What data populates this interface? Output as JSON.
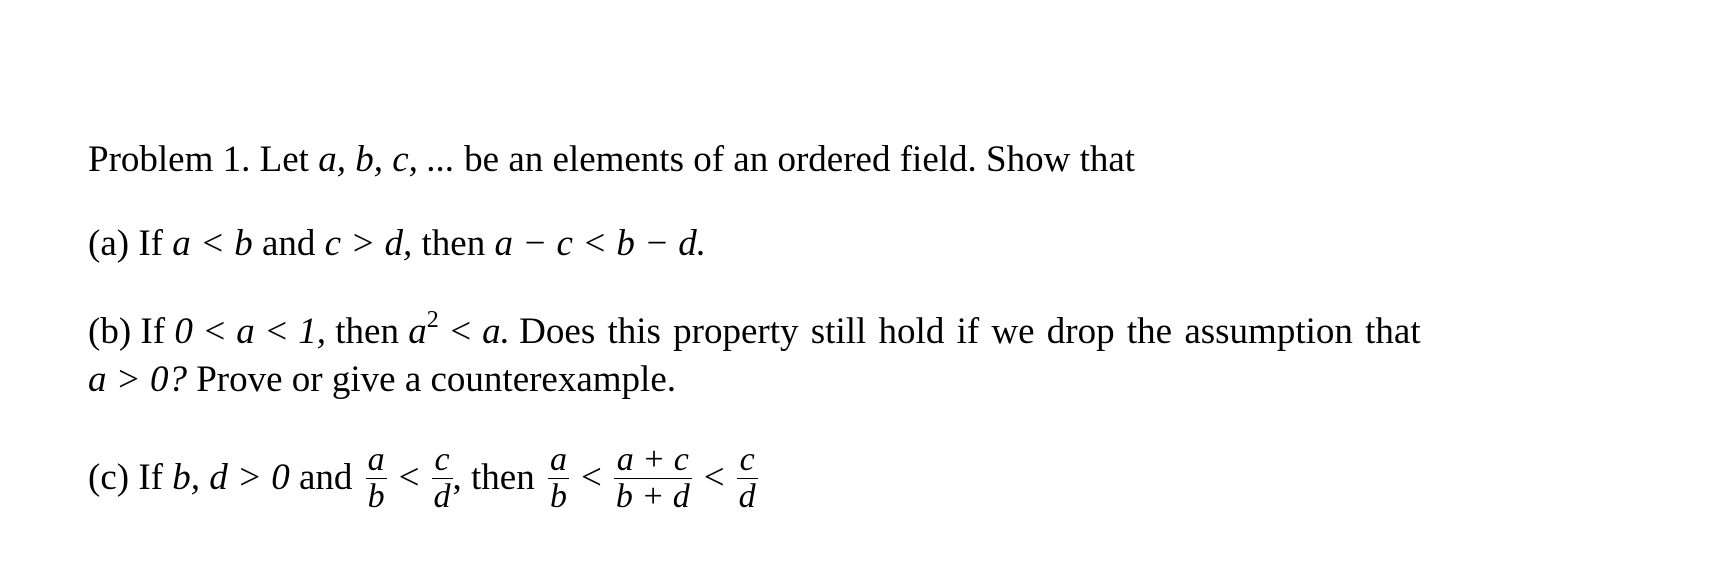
{
  "problem": {
    "title": "Problem 1.",
    "intro_text": "Let",
    "vars_list": "a, b, c, ...",
    "intro_rest": "be an elements of an ordered field. Show that"
  },
  "parts": {
    "a": {
      "label": "(a)",
      "if": "If",
      "cond1": "a < b",
      "and": "and",
      "cond2": "c > d,",
      "then": "then",
      "concl": "a − c < b − d."
    },
    "b": {
      "label": "(b)",
      "if": "If",
      "cond": "0 < a < 1,",
      "then": "then",
      "concl_base": "a",
      "concl_exp": "2",
      "concl_rest": "< a.",
      "question": "Does this property still hold if we drop the assumption that",
      "line2_math": "a > 0?",
      "line2_text": "Prove or give a counterexample."
    },
    "c": {
      "label": "(c)",
      "if": "If",
      "cond": "b, d > 0",
      "and": "and",
      "frac1": {
        "num": "a",
        "den": "b"
      },
      "lt": "<",
      "frac2": {
        "num": "c",
        "den": "d"
      },
      "comma": ",",
      "then": "then",
      "frac3": {
        "num": "a",
        "den": "b"
      },
      "frac4": {
        "num": "a + c",
        "den": "b + d"
      },
      "frac5": {
        "num": "c",
        "den": "d"
      }
    }
  }
}
